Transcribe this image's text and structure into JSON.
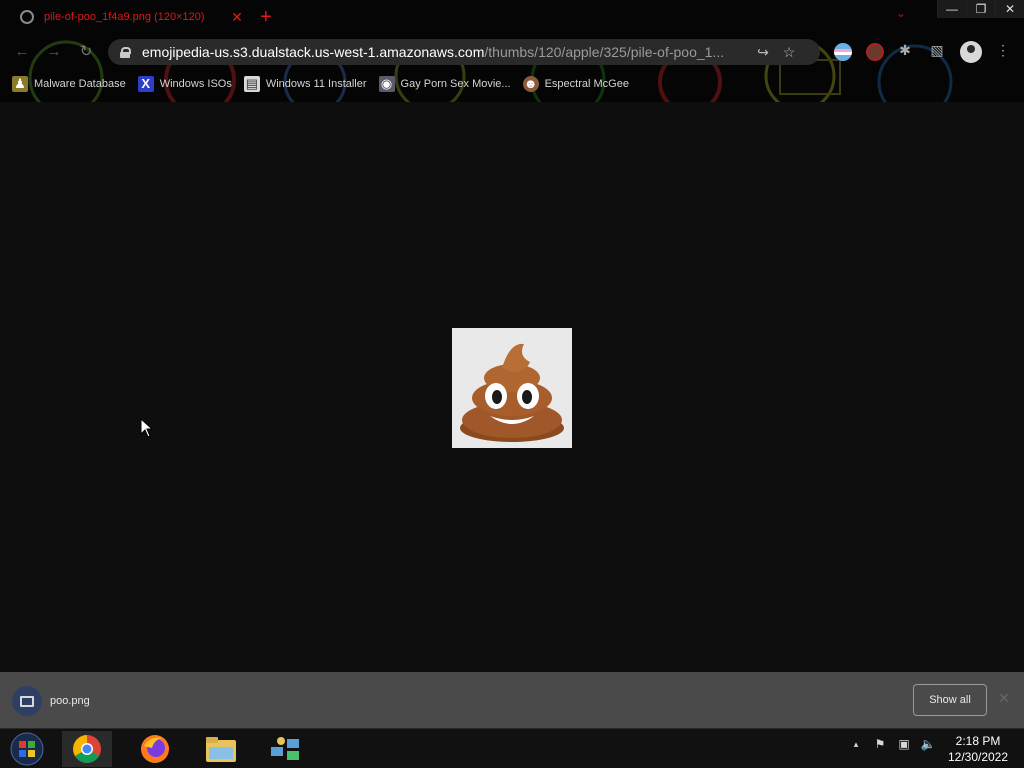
{
  "window": {
    "tab_title": "pile-of-poo_1f4a9.png (120×120)",
    "tab_close": "✕",
    "new_tab": "+",
    "tab_search": "⌄",
    "minimize": "—",
    "restore": "❐",
    "close": "✕"
  },
  "toolbar": {
    "back": "←",
    "forward": "→",
    "reload": "↻",
    "url_host": "emojipedia-us.s3.dualstack.us-west-1.amazonaws.com",
    "url_path": "/thumbs/120/apple/325/pile-of-poo_1...",
    "share_icon": "↪",
    "star_icon": "☆",
    "puzzle_icon": "✱",
    "sidepanel_icon": "▧",
    "menu_icon": "⋮"
  },
  "bookmarks": [
    {
      "label": "Malware Database",
      "icon": "user-icon",
      "color": "#8a7a2a"
    },
    {
      "label": "Windows ISOs",
      "icon": "x-logo-icon",
      "color": "#2d3fc9"
    },
    {
      "label": "Windows 11 Installer",
      "icon": "document-icon",
      "color": "#7a7a7a"
    },
    {
      "label": "Gay Porn Sex Movie...",
      "icon": "site-icon",
      "color": "#5a5a6a"
    },
    {
      "label": "Espectral McGee",
      "icon": "avatar-icon",
      "color": "#8a5a3a"
    }
  ],
  "content": {
    "image_emoji": "pile-of-poo",
    "image_bg": "#e9e9e9"
  },
  "downloads": {
    "file_name": "poo.png",
    "show_all": "Show all",
    "close": "✕"
  },
  "taskbar": {
    "apps": [
      "start-orb",
      "chrome",
      "firefox",
      "file-explorer",
      "network-app"
    ],
    "time": "2:18 PM",
    "date": "12/30/2022",
    "tray_arrow": "▴",
    "tray_flag": "⚑",
    "tray_network": "▣",
    "tray_volume": "🔈"
  },
  "colors": {
    "tab_text": "#e01818",
    "page_bg": "#0e0e0e",
    "download_bar": "#4a4a4a"
  }
}
